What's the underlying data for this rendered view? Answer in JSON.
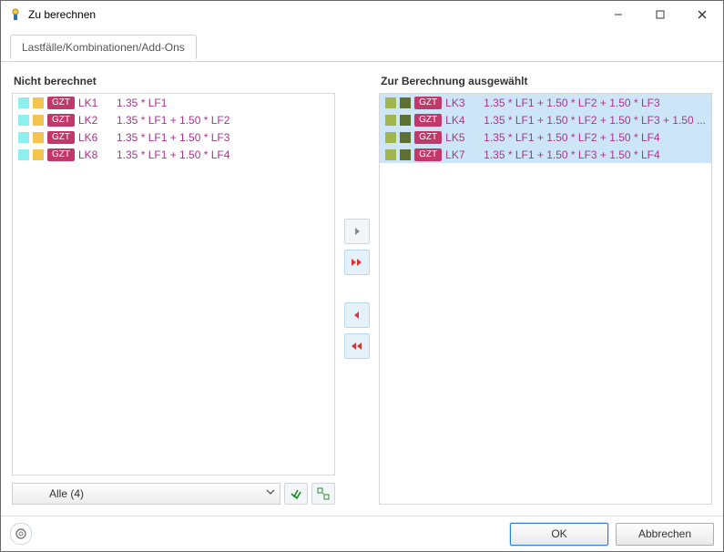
{
  "window": {
    "title": "Zu berechnen"
  },
  "tab": {
    "label": "Lastfälle/Kombinationen/Add-Ons"
  },
  "left": {
    "header": "Nicht berechnet",
    "items": [
      {
        "code": "LK1",
        "formula": "1.35 * LF1"
      },
      {
        "code": "LK2",
        "formula": "1.35 * LF1 + 1.50 * LF2"
      },
      {
        "code": "LK6",
        "formula": "1.35 * LF1 + 1.50 * LF3"
      },
      {
        "code": "LK8",
        "formula": "1.35 * LF1 + 1.50 * LF4"
      }
    ],
    "badge": "GZT",
    "filter": "Alle (4)"
  },
  "right": {
    "header": "Zur Berechnung ausgewählt",
    "items": [
      {
        "code": "LK3",
        "formula": "1.35 * LF1 + 1.50 * LF2 + 1.50 * LF3"
      },
      {
        "code": "LK4",
        "formula": "1.35 * LF1 + 1.50 * LF2 + 1.50 * LF3 + 1.50 ..."
      },
      {
        "code": "LK5",
        "formula": "1.35 * LF1 + 1.50 * LF2 + 1.50 * LF4"
      },
      {
        "code": "LK7",
        "formula": "1.35 * LF1 + 1.50 * LF3 + 1.50 * LF4"
      }
    ],
    "badge": "GZT"
  },
  "buttons": {
    "ok": "OK",
    "cancel": "Abbrechen"
  },
  "icons": {
    "move_right": "chevron-right-icon",
    "move_all_right": "double-chevron-right-icon",
    "move_left": "chevron-left-icon",
    "move_all_left": "double-chevron-left-icon",
    "check_all": "check-all-icon",
    "select_unique": "select-filter-icon",
    "help": "help-icon"
  }
}
